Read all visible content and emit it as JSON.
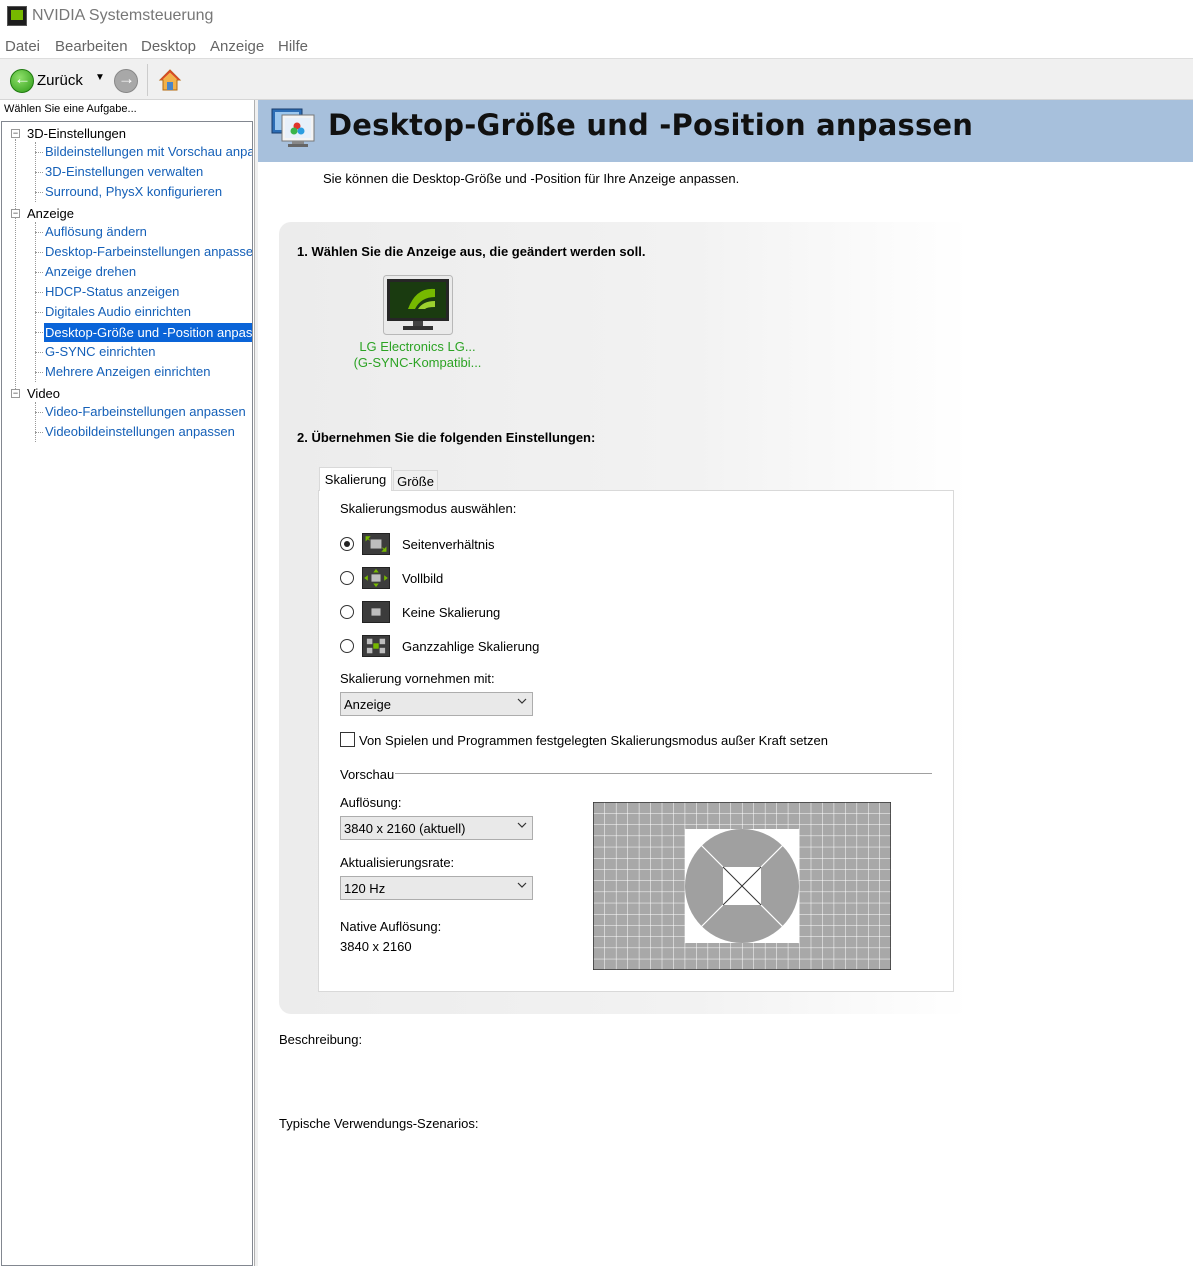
{
  "window": {
    "title": "NVIDIA Systemsteuerung"
  },
  "menu": [
    "Datei",
    "Bearbeiten",
    "Desktop",
    "Anzeige",
    "Hilfe"
  ],
  "toolbar": {
    "back_label": "Zurück"
  },
  "sidebar": {
    "task_label": "Wählen Sie eine Aufgabe...",
    "groups": [
      {
        "label": "3D-Einstellungen",
        "items": [
          "Bildeinstellungen mit Vorschau anpa",
          "3D-Einstellungen verwalten",
          "Surround, PhysX konfigurieren"
        ]
      },
      {
        "label": "Anzeige",
        "items": [
          "Auflösung ändern",
          "Desktop-Farbeinstellungen anpasser",
          "Anzeige drehen",
          "HDCP-Status anzeigen",
          "Digitales Audio einrichten",
          "Desktop-Größe und -Position anpass",
          "G-SYNC einrichten",
          "Mehrere Anzeigen einrichten"
        ]
      },
      {
        "label": "Video",
        "items": [
          "Video-Farbeinstellungen anpassen",
          "Videobildeinstellungen anpassen"
        ]
      }
    ],
    "selected": "Desktop-Größe und -Position anpass"
  },
  "page": {
    "title": "Desktop-Größe und -Position anpassen",
    "intro": "Sie können die Desktop-Größe und -Position für Ihre Anzeige anpassen.",
    "step1": "1. Wählen Sie die Anzeige aus, die geändert werden soll.",
    "monitor": {
      "name_line1": "LG Electronics LG...",
      "name_line2": "(G-SYNC-Kompatibi..."
    },
    "step2": "2. Übernehmen Sie die folgenden Einstellungen:",
    "tabs": [
      "Skalierung",
      "Größe"
    ],
    "active_tab": "Skalierung",
    "scaling_mode_label": "Skalierungsmodus auswählen:",
    "scaling_modes": [
      {
        "label": "Seitenverhältnis",
        "checked": true
      },
      {
        "label": "Vollbild",
        "checked": false
      },
      {
        "label": "Keine Skalierung",
        "checked": false
      },
      {
        "label": "Ganzzahlige Skalierung",
        "checked": false
      }
    ],
    "scaling_on_label": "Skalierung vornehmen mit:",
    "scaling_on_value": "Anzeige",
    "override_label": "Von Spielen und Programmen festgelegten Skalierungsmodus außer Kraft setzen",
    "override_checked": false,
    "preview_label": "Vorschau",
    "resolution_label": "Auflösung:",
    "resolution_value": "3840 x 2160 (aktuell)",
    "refresh_label": "Aktualisierungsrate:",
    "refresh_value": "120 Hz",
    "native_label": "Native Auflösung:",
    "native_value": "3840 x 2160",
    "description_label": "Beschreibung:",
    "usage_label": "Typische Verwendungs-Szenarios:"
  },
  "colors": {
    "header_bg": "#a7c0dc",
    "link": "#1560b8",
    "selection": "#0a64d8",
    "monitor_label": "#2ca324",
    "nvidia_green": "#76b900"
  }
}
